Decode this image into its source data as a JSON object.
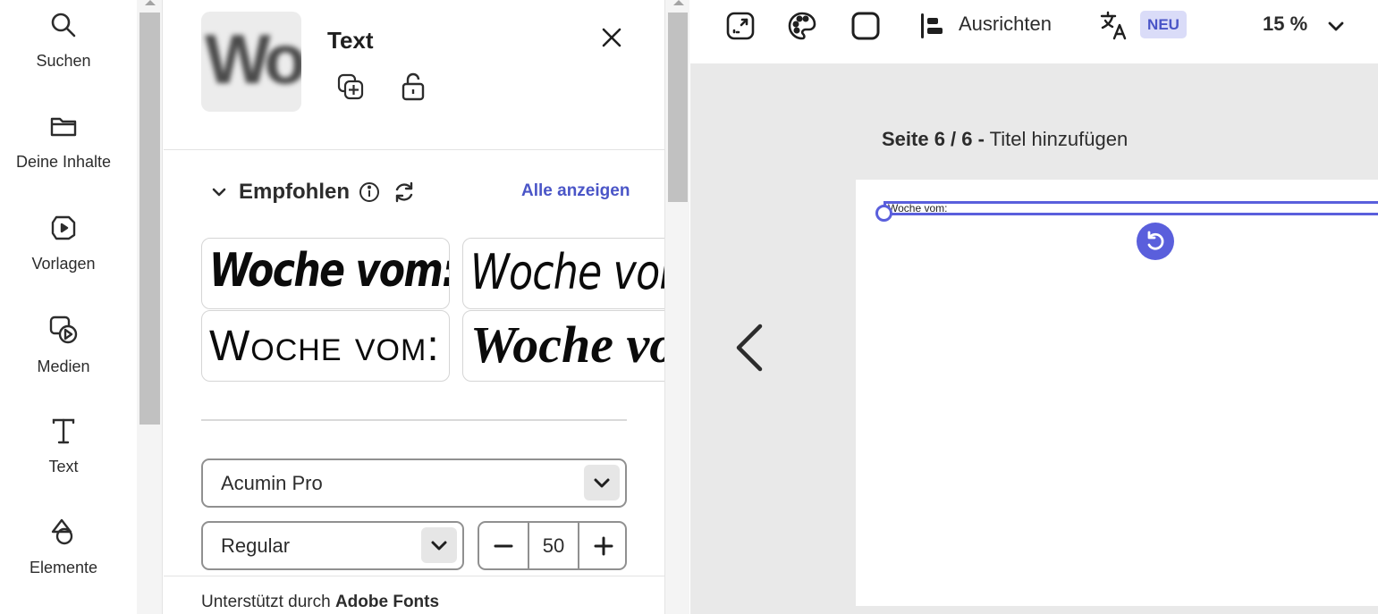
{
  "rail": {
    "items": [
      {
        "label": "Suchen",
        "icon": "search-icon"
      },
      {
        "label": "Deine Inhalte",
        "icon": "folder-icon"
      },
      {
        "label": "Vorlagen",
        "icon": "templates-icon"
      },
      {
        "label": "Medien",
        "icon": "media-icon"
      },
      {
        "label": "Text",
        "icon": "text-icon"
      },
      {
        "label": "Elemente",
        "icon": "shapes-icon"
      }
    ]
  },
  "panel": {
    "title": "Text",
    "preview_text": "Wo",
    "recommended": {
      "title": "Empfohlen",
      "show_all": "Alle anzeigen",
      "samples": [
        "Woche vom:___",
        "Woche vom:",
        "Woche vom:",
        "Woche vom:"
      ]
    },
    "font_family": "Acumin Pro",
    "font_style": "Regular",
    "font_size": "50",
    "footer": {
      "prefix": "Unterstützt durch ",
      "brand": "Adobe Fonts"
    }
  },
  "toolbar": {
    "align_label": "Ausrichten",
    "new_badge": "NEU",
    "zoom": "15 %"
  },
  "canvas": {
    "page_label": "Seite 6 / 6 -",
    "page_title_placeholder": "Titel hinzufügen",
    "page_text": "Woche vom:___________"
  },
  "colors": {
    "accent": "#5a5fdc",
    "link": "#4a55c7",
    "badge_bg": "#dadcf8",
    "canvas_bg": "#e9e9e9"
  }
}
